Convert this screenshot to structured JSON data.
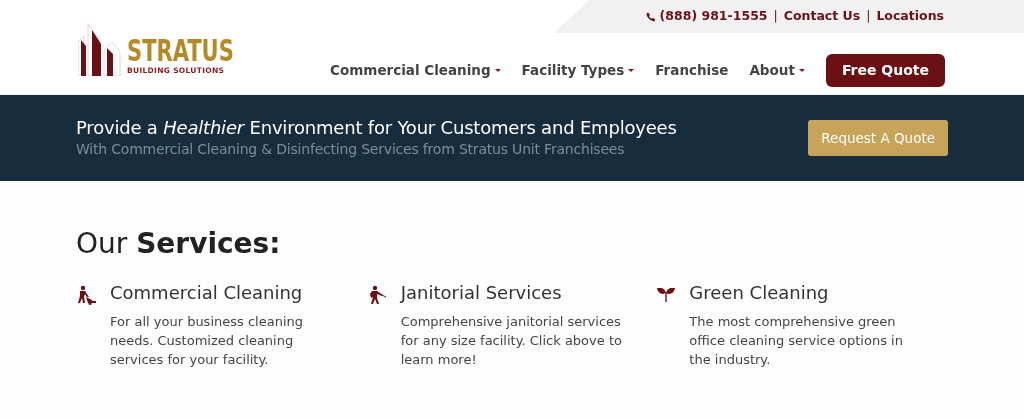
{
  "topbar": {
    "items": [
      {
        "kind": "phone",
        "text": "(888) 981-1555"
      },
      {
        "kind": "separator",
        "text": "|"
      },
      {
        "kind": "link",
        "text": "Contact Us"
      },
      {
        "kind": "separator",
        "text": "|"
      },
      {
        "kind": "link",
        "text": "Locations"
      }
    ]
  },
  "logo": {
    "name": "STRATUS",
    "tagline": "BUILDING SOLUTIONS"
  },
  "nav": {
    "items": [
      {
        "label": "Commercial Cleaning",
        "dropdown": true
      },
      {
        "label": "Facility Types",
        "dropdown": true
      },
      {
        "label": "Franchise",
        "dropdown": false
      },
      {
        "label": "About",
        "dropdown": true
      }
    ],
    "cta": "Free Quote"
  },
  "banner": {
    "headline": "Provide a *Healthier* Environment for Your Customers and Employees",
    "subline": "With Commercial Cleaning & Disinfecting Services from Stratus Unit Franchisees",
    "button": "Request A Quote"
  },
  "services": {
    "heading": "Our **Services:**",
    "items": [
      {
        "kind": "mower",
        "title": "Commercial Cleaning",
        "text": "For all your business cleaning needs. Customized cleaning services for your facility."
      },
      {
        "kind": "sprayer",
        "title": "Janitorial Services",
        "text": "Comprehensive janitorial services for any size facility. Click above to learn more!"
      },
      {
        "kind": "leaf",
        "title": "Green Cleaning",
        "text": "The most comprehensive green office cleaning service options in the industry."
      }
    ]
  }
}
